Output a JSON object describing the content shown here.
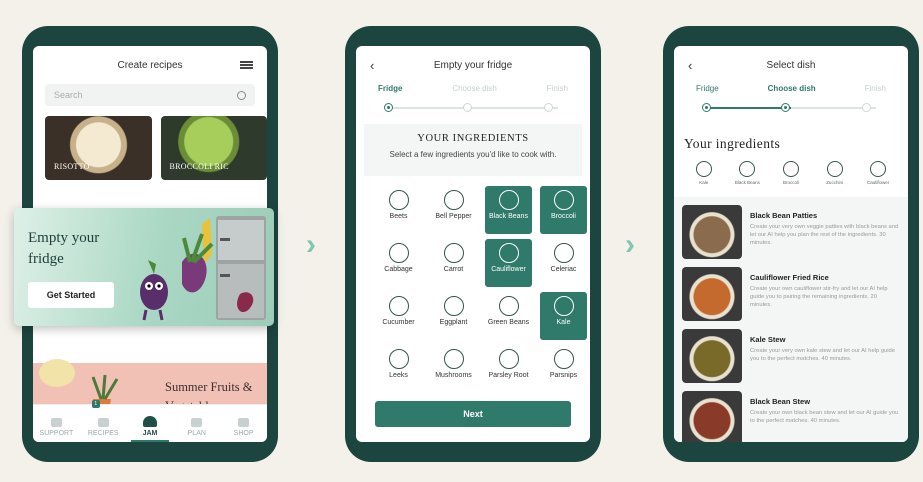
{
  "screen1": {
    "title": "Create recipes",
    "search_placeholder": "Search",
    "recipes": [
      {
        "label": "RISOTTO"
      },
      {
        "label": "BROCCOLI RIC"
      }
    ],
    "promo": {
      "title": "Empty your fridge",
      "button": "Get Started"
    },
    "summer": {
      "title": "Summer Fruits & Vegetables"
    },
    "nav": [
      {
        "label": "SUPPORT",
        "icon": "chat-icon"
      },
      {
        "label": "RECIPES",
        "icon": "book-icon",
        "badge": "1"
      },
      {
        "label": "JAM",
        "icon": "chef-hat-icon",
        "active": true
      },
      {
        "label": "PLAN",
        "icon": "calendar-icon"
      },
      {
        "label": "SHOP",
        "icon": "basket-icon"
      }
    ]
  },
  "screen2": {
    "title": "Empty your fridge",
    "steps": [
      "Fridge",
      "Choose dish",
      "Finish"
    ],
    "active_step": 0,
    "heading": "YOUR INGREDIENTS",
    "subheading": "Select a few ingredients you'd like to cook with.",
    "ingredients": [
      {
        "label": "Beets",
        "selected": false
      },
      {
        "label": "Bell Pepper",
        "selected": false
      },
      {
        "label": "Black Beans",
        "selected": true
      },
      {
        "label": "Broccoli",
        "selected": true
      },
      {
        "label": "Cabbage",
        "selected": false
      },
      {
        "label": "Carrot",
        "selected": false
      },
      {
        "label": "Cauliflower",
        "selected": true
      },
      {
        "label": "Celeriac",
        "selected": false
      },
      {
        "label": "Cucumber",
        "selected": false
      },
      {
        "label": "Eggplant",
        "selected": false
      },
      {
        "label": "Green Beans",
        "selected": false
      },
      {
        "label": "Kale",
        "selected": true
      },
      {
        "label": "Leeks",
        "selected": false
      },
      {
        "label": "Mushrooms",
        "selected": false
      },
      {
        "label": "Parsley Root",
        "selected": false
      },
      {
        "label": "Parsnips",
        "selected": false
      }
    ],
    "next_label": "Next"
  },
  "screen3": {
    "title": "Select dish",
    "steps": [
      "Fridge",
      "Choose dish",
      "Finish"
    ],
    "active_step": 1,
    "heading": "Your ingredients",
    "chips": [
      "Kale",
      "Black Beans",
      "Broccoli",
      "Zucchini",
      "Cauliflower"
    ],
    "dishes": [
      {
        "name": "Black Bean Patties",
        "desc": "Create your very own veggie patties with black beans and let our AI help you plan the rest of the ingredients. 30 minutes.",
        "color": "#8b6b4e"
      },
      {
        "name": "Cauliflower Fried Rice",
        "desc": "Create your own cauliflower stir-fry and let our AI help guide you to pairing the remaining ingredients. 20 minutes.",
        "color": "#c46a2f"
      },
      {
        "name": "Kale Stew",
        "desc": "Create your very own kale stew and let our AI help guide you to the perfect matches. 40 minutes.",
        "color": "#7a6a2a"
      },
      {
        "name": "Black Bean Stew",
        "desc": "Create your own black bean stew and let our AI guide you to the perfect matches. 40 minutes.",
        "color": "#8a3a28"
      }
    ]
  },
  "colors": {
    "accent": "#2f7a6a",
    "phone": "#1d4540",
    "arrow": "#7fc7b0"
  }
}
